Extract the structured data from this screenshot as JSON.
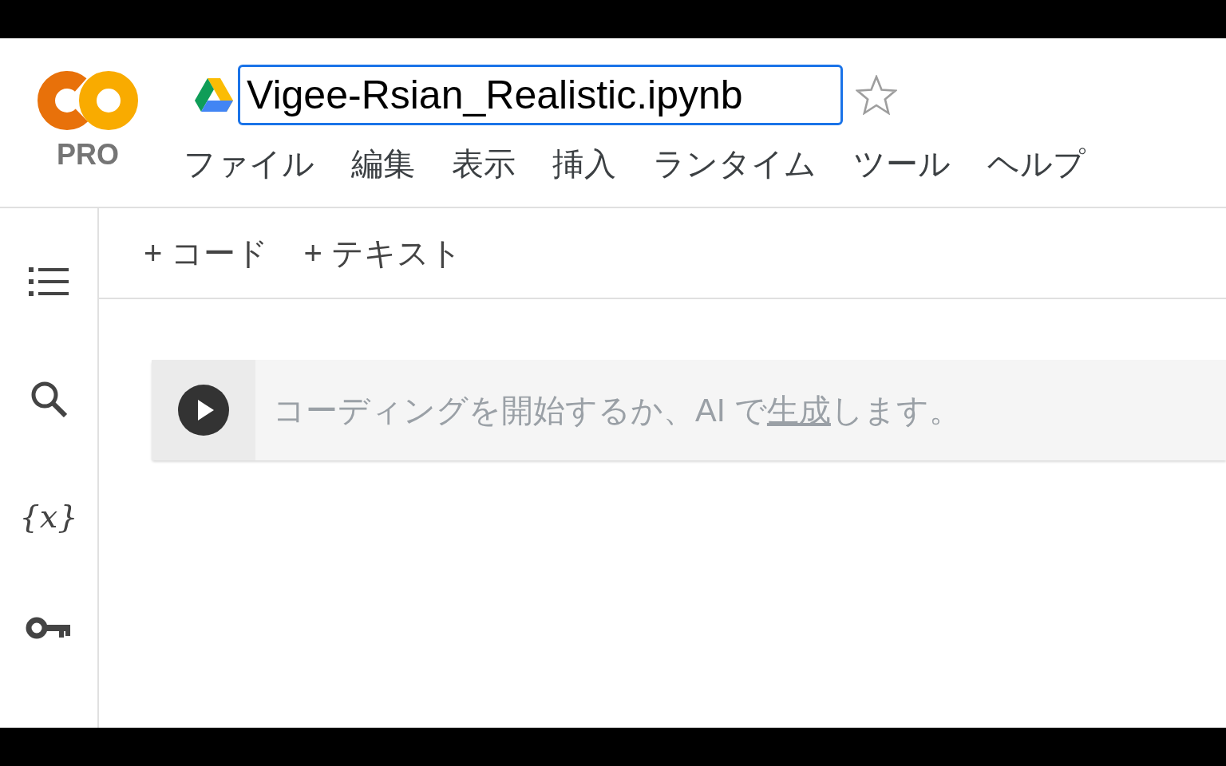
{
  "header": {
    "logo_label": "PRO",
    "title": "Vigee-Rsian_Realistic.ipynb",
    "starred": false
  },
  "menu": [
    "ファイル",
    "編集",
    "表示",
    "挿入",
    "ランタイム",
    "ツール",
    "ヘルプ"
  ],
  "sidebar": {
    "items": [
      {
        "kind": "toc"
      },
      {
        "kind": "search"
      },
      {
        "kind": "variables",
        "label": "{x}"
      },
      {
        "kind": "secrets"
      }
    ]
  },
  "toolbar": [
    {
      "icon": "+",
      "label": "コード"
    },
    {
      "icon": "+",
      "label": "テキスト"
    }
  ],
  "cell": {
    "placeholder_before": "コーディングを開始するか、AI で",
    "placeholder_link": "生成",
    "placeholder_after": "します。"
  }
}
